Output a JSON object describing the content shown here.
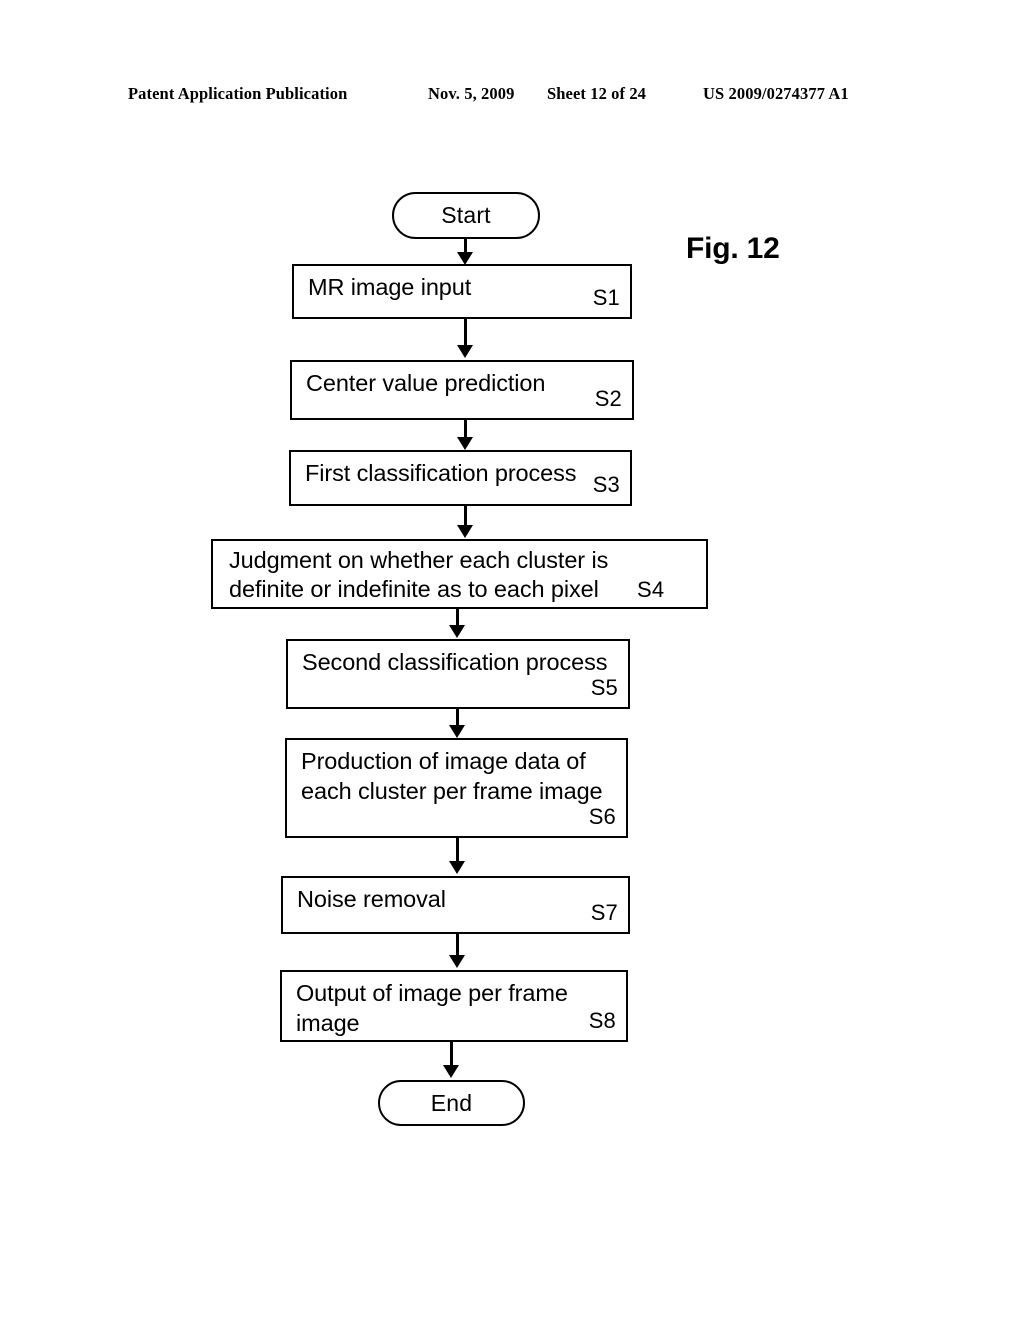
{
  "header": {
    "publication": "Patent Application Publication",
    "date": "Nov. 5, 2009",
    "sheet": "Sheet 12 of 24",
    "patent_number": "US 2009/0274377 A1"
  },
  "figure": {
    "label": "Fig. 12"
  },
  "flowchart": {
    "start_label": "Start",
    "end_label": "End",
    "steps": [
      {
        "code": "S1",
        "line1": "MR image input",
        "line2": ""
      },
      {
        "code": "S2",
        "line1": "Center value prediction",
        "line2": ""
      },
      {
        "code": "S3",
        "line1": "First classification process",
        "line2": ""
      },
      {
        "code": "S4",
        "line1": "Judgment on whether each cluster is",
        "line2": "definite or indefinite as to each pixel"
      },
      {
        "code": "S5",
        "line1": "Second classification process",
        "line2": ""
      },
      {
        "code": "S6",
        "line1": "Production of image data of",
        "line2": "each cluster per frame image"
      },
      {
        "code": "S7",
        "line1": "Noise removal",
        "line2": ""
      },
      {
        "code": "S8",
        "line1": "Output of image per frame",
        "line2": "image"
      }
    ]
  }
}
